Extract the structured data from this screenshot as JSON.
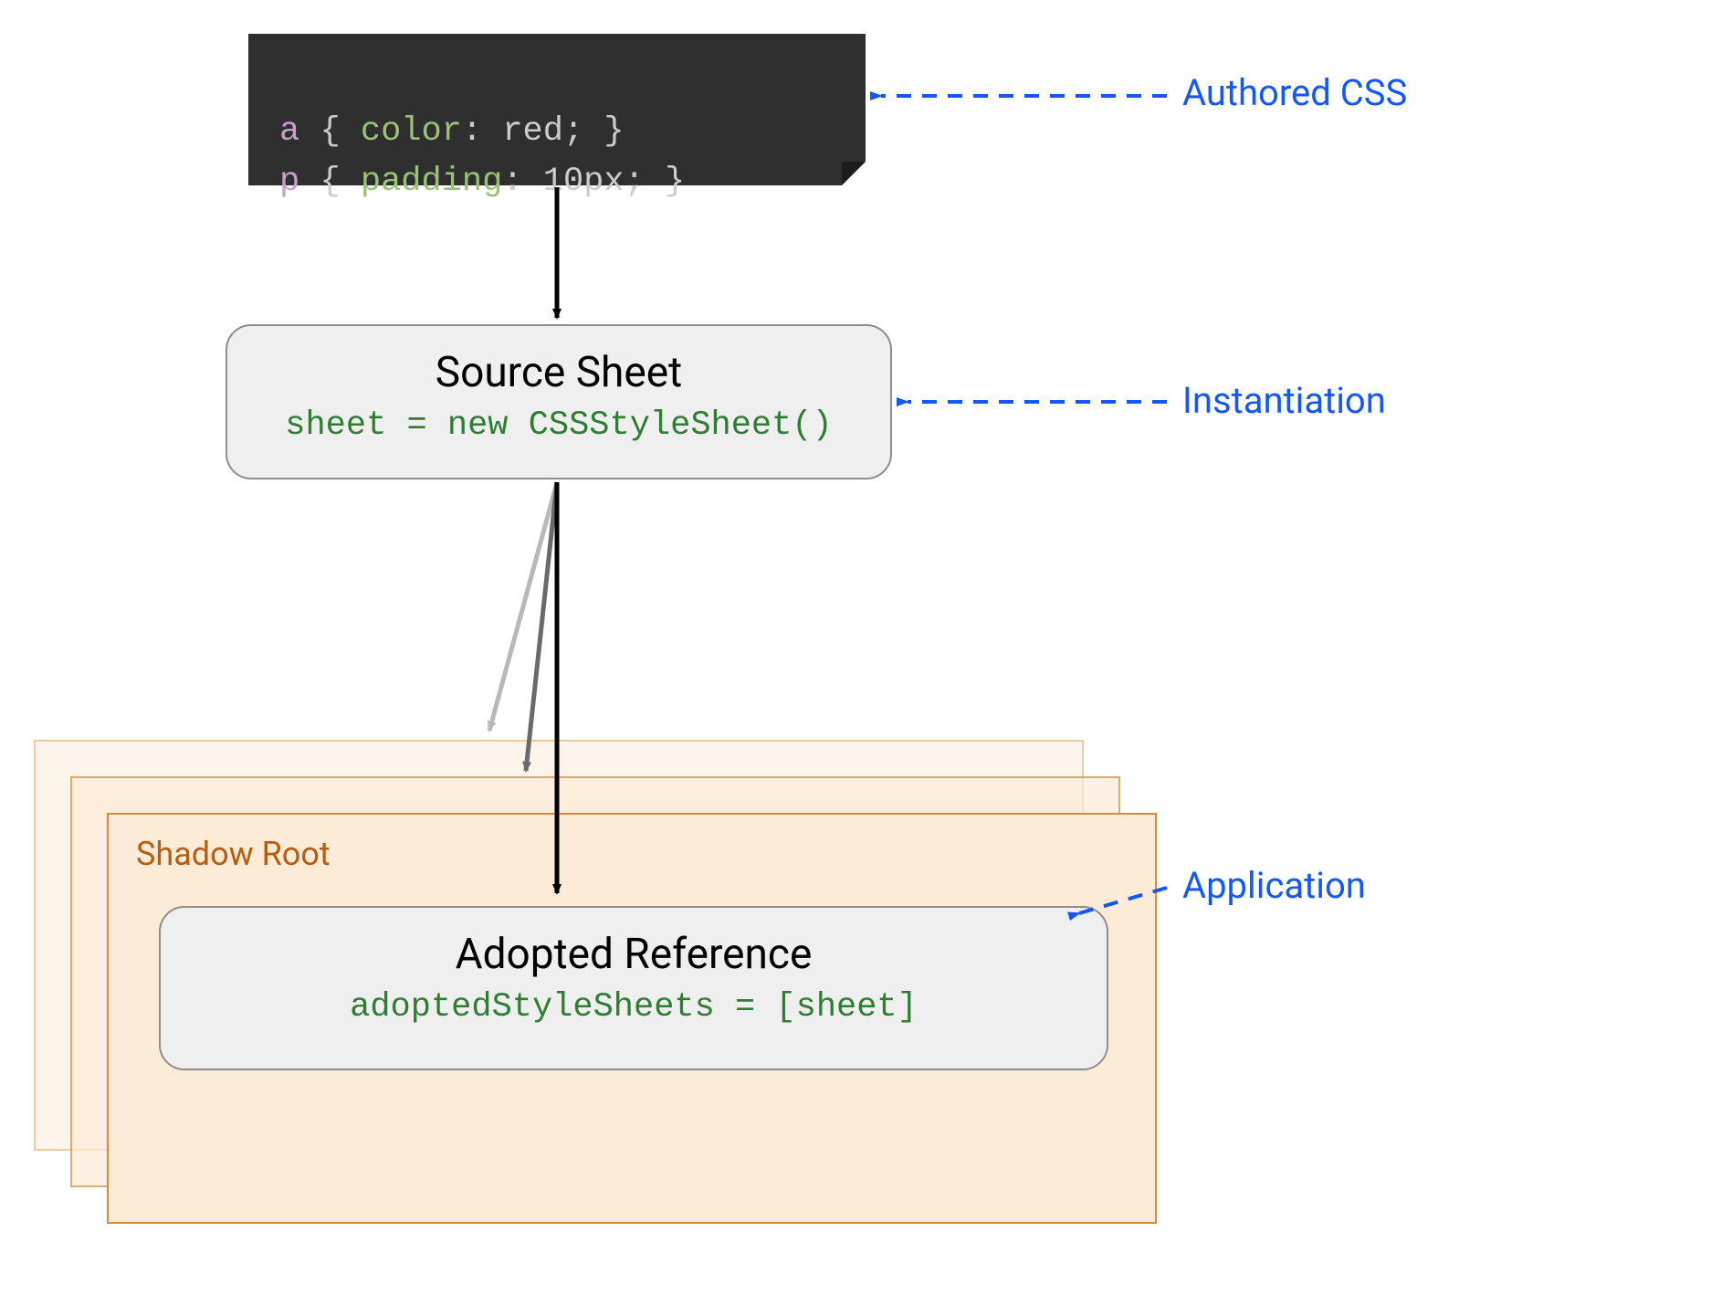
{
  "code_block": {
    "line1": {
      "sel": "a",
      "brace_open": "{",
      "prop": "color",
      "colon": ":",
      "val": "red",
      "semi": ";",
      "brace_close": "}"
    },
    "line2": {
      "sel": "p",
      "brace_open": "{",
      "prop": "padding",
      "colon": ":",
      "val": "10px",
      "semi": ";",
      "brace_close": "}"
    }
  },
  "source_sheet": {
    "title": "Source Sheet",
    "code": "sheet = new CSSStyleSheet()"
  },
  "shadow_root": {
    "label": "Shadow Root"
  },
  "adopted": {
    "title": "Adopted Reference",
    "code": "adoptedStyleSheets = [sheet]"
  },
  "annotations": {
    "authored": "Authored CSS",
    "instantiation": "Instantiation",
    "application": "Application"
  }
}
